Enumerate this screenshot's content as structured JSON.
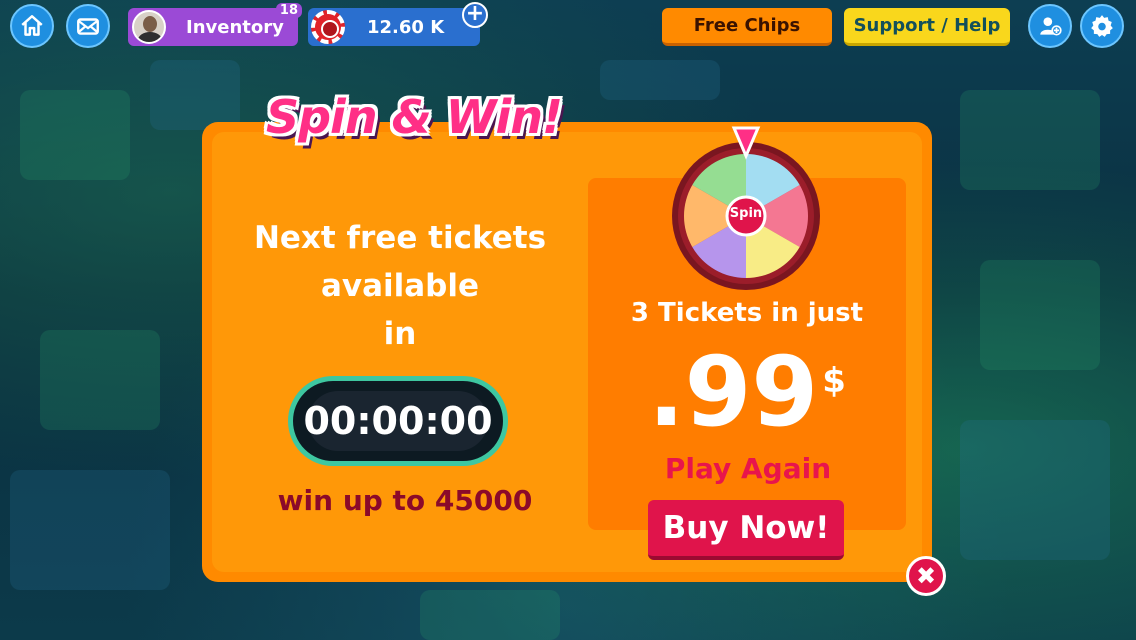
{
  "topbar": {
    "home_icon": "home-icon",
    "mail_icon": "mail-icon",
    "inventory_label": "Inventory",
    "inventory_badge": "18",
    "chips_value": "12.60 K",
    "add_chips_symbol": "+",
    "free_chips_label": "Free Chips",
    "support_label": "Support / Help",
    "add_friend_icon": "add-friend-icon",
    "settings_icon": "gear-icon"
  },
  "modal": {
    "title": "Spin & Win!",
    "next_line1": "Next free tickets",
    "next_line2": "available",
    "next_line3": "in",
    "timer": "00:00:00",
    "win_up": "win up to 45000",
    "wheel_label": "Spin",
    "tickets_text": "3 Tickets in just",
    "price": ".99",
    "currency": "$",
    "play_again": "Play Again",
    "buy_now": "Buy Now!",
    "close_symbol": "✖"
  },
  "colors": {
    "modal_orange": "#ff8a00",
    "accent_pink": "#e0144b",
    "title_pink": "#ff2f86",
    "timer_border": "#3ec7a0",
    "top_button_blue": "#1f8fe0"
  }
}
